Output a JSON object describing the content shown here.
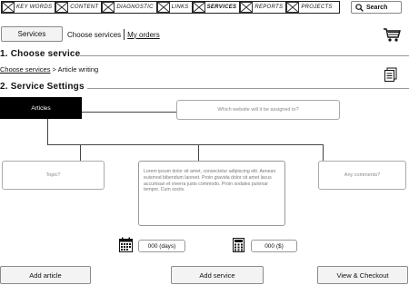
{
  "nav": {
    "items": [
      {
        "label": "KEY WORDS",
        "active": false
      },
      {
        "label": "CONTENT",
        "active": false
      },
      {
        "label": "DIAGNOSTIC",
        "active": false
      },
      {
        "label": "LINKS",
        "active": false
      },
      {
        "label": "SERVICES",
        "active": true
      },
      {
        "label": "REPORTS",
        "active": false
      },
      {
        "label": "PROJECTS",
        "active": false
      }
    ],
    "search_label": "Search"
  },
  "services_button": "Services",
  "tabs": {
    "choose": "Choose services",
    "orders": "My orders"
  },
  "section1": {
    "title": "1. Choose service"
  },
  "breadcrumb": {
    "link": "Choose services",
    "separator": " > ",
    "current": "Article writing"
  },
  "section2": {
    "title": "2. Service Settings"
  },
  "articles_label": "Articles",
  "website_placeholder": "Which website will it be assigned to?",
  "topic_placeholder": "Topic?",
  "comments_placeholder": "Any comments?",
  "lorem_text": "Lorem ipsum dolor sit amet, consectetur adipiscing elit. Aenean euismod bibendum laoreet. Proin gravida dolor sit amet lacus accumsan et viverra justo commodo. Proin sodales pulvinar tempor. Cum sociis.",
  "days_value": "000 (days)",
  "cost_value": "000 ($)",
  "buttons": {
    "add_article": "Add article",
    "add_service": "Add service",
    "checkout": "View & Checkout"
  }
}
